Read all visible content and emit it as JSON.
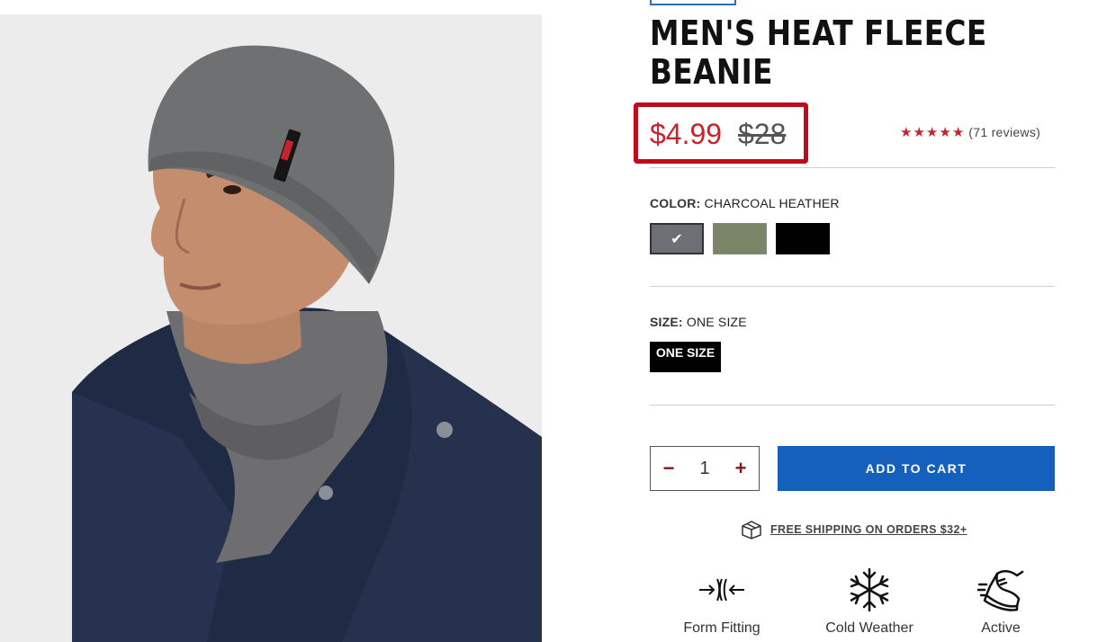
{
  "product": {
    "title": "MEN'S HEAT FLEECE BEANIE",
    "price_sale": "$4.99",
    "price_original": "$28",
    "rating_stars": 5,
    "reviews": "(71 reviews)",
    "image_icon": "beanie-model-photo"
  },
  "color": {
    "label": "COLOR:",
    "value": "CHARCOAL HEATHER",
    "swatches": [
      {
        "name": "charcoal-heather",
        "hex": "#6c7074",
        "selected": true
      },
      {
        "name": "olive",
        "hex": "#7a8466",
        "selected": false
      },
      {
        "name": "black",
        "hex": "#000000",
        "selected": false
      }
    ]
  },
  "size": {
    "label": "SIZE:",
    "value": "ONE SIZE",
    "button_label": "ONE SIZE"
  },
  "quantity": {
    "minus": "−",
    "value": "1",
    "plus": "+"
  },
  "cart": {
    "label": "ADD TO CART"
  },
  "shipping": {
    "text": "FREE SHIPPING ON ORDERS $32+"
  },
  "features": [
    {
      "label": "Form Fitting",
      "icon": "form-fitting-icon"
    },
    {
      "label": "Cold Weather",
      "icon": "snowflake-icon"
    },
    {
      "label": "Active",
      "icon": "running-shoe-icon"
    }
  ],
  "colors": {
    "accent_red": "#c8232c",
    "highlight_box": "#c00a1b",
    "cart_blue": "#1560bd"
  }
}
